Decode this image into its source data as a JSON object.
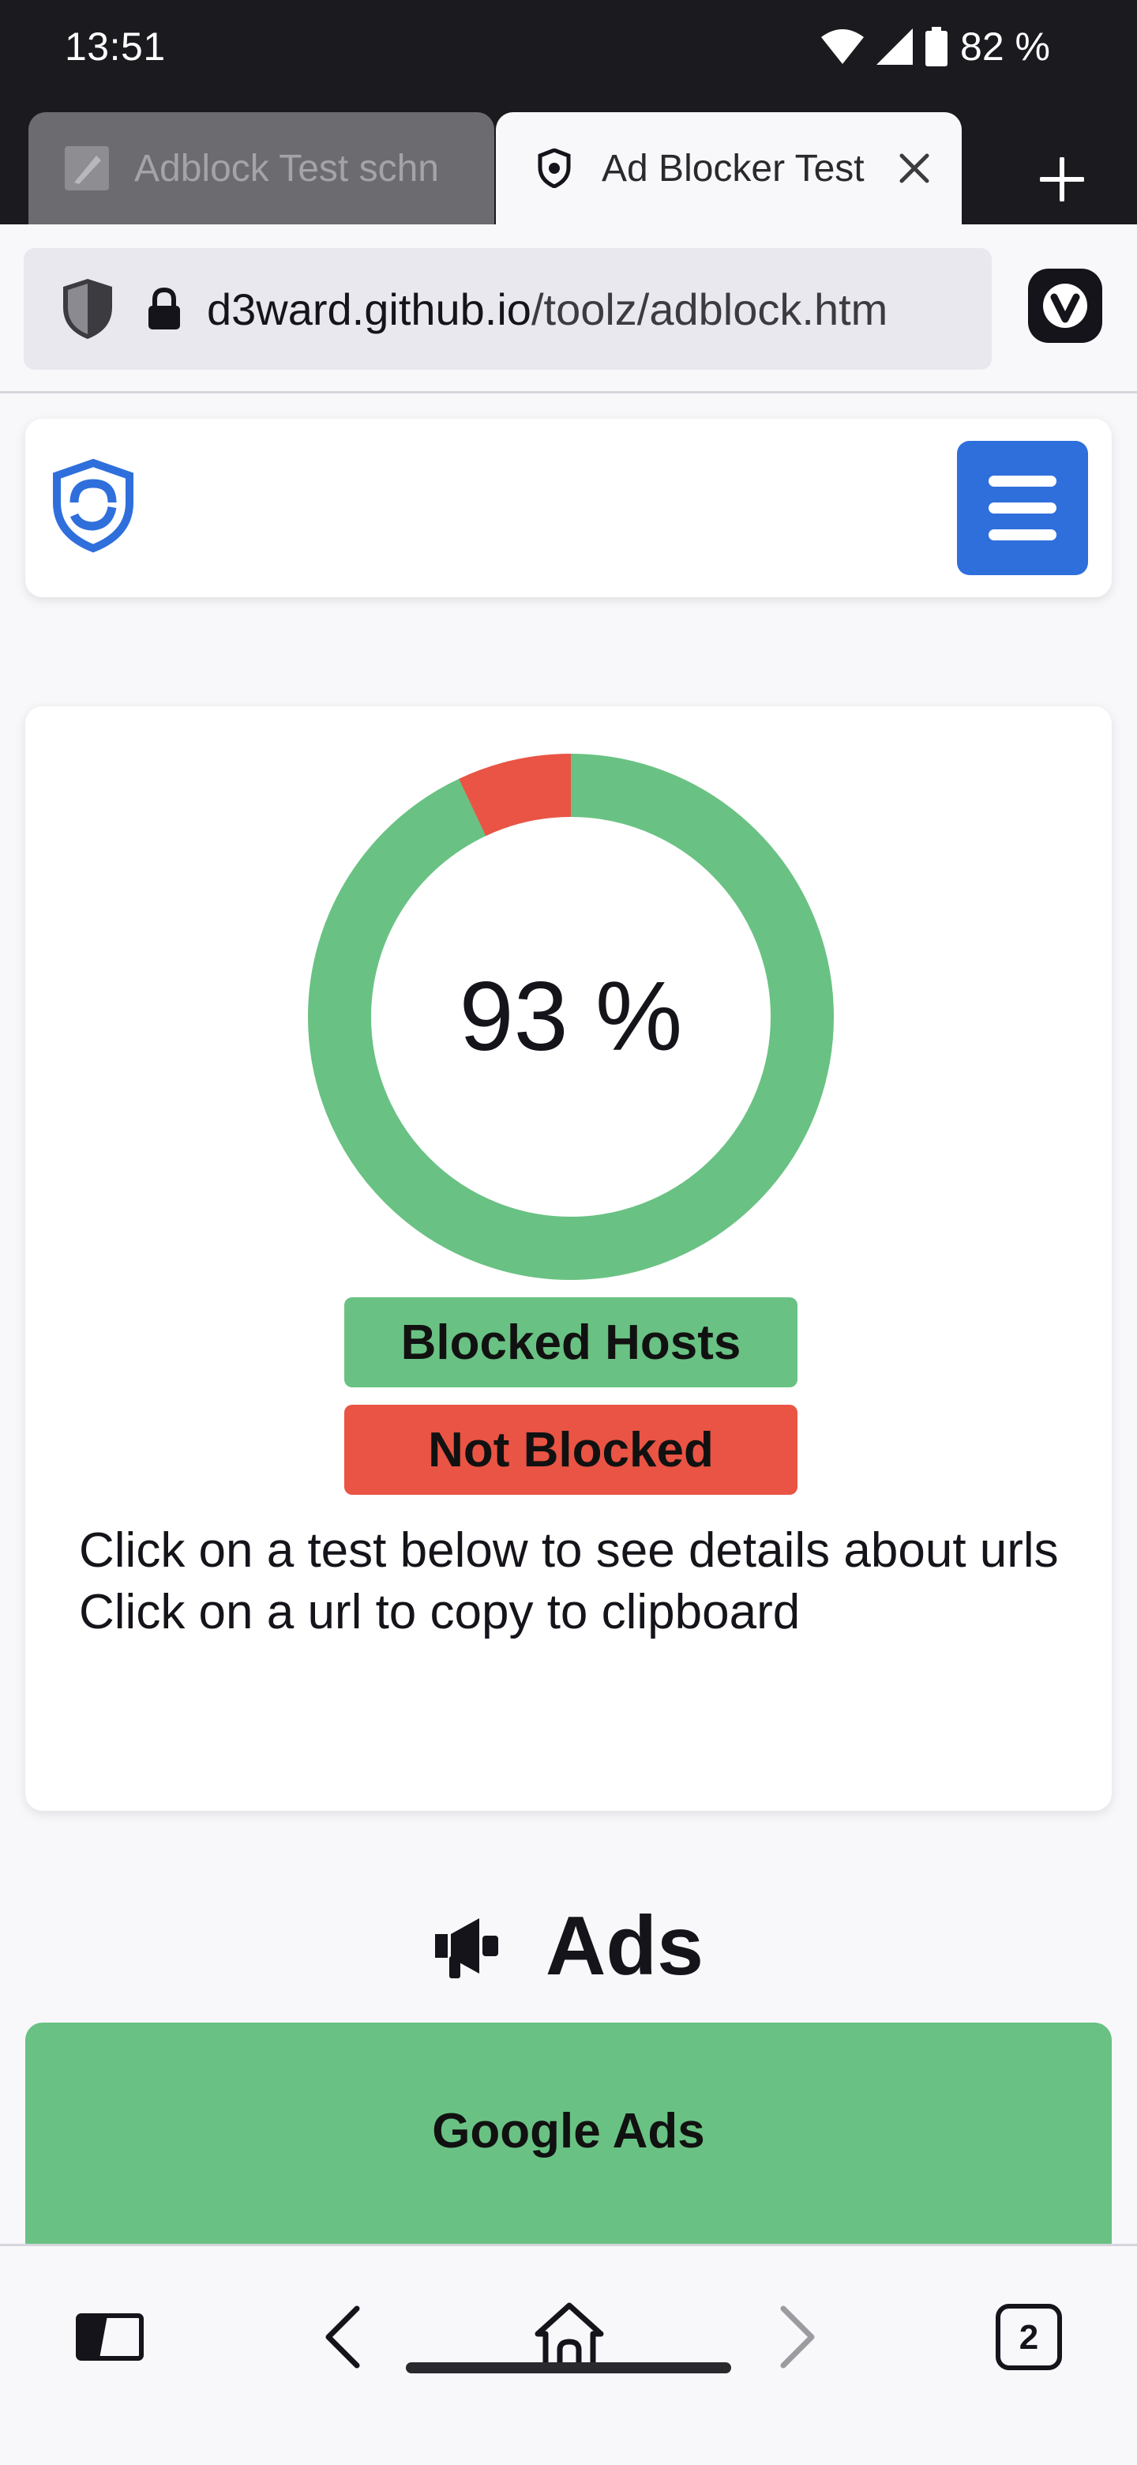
{
  "status_bar": {
    "time": "13:51",
    "battery": "82 %"
  },
  "tabs": [
    {
      "title": "Adblock Test schn",
      "active": false
    },
    {
      "title": "Ad Blocker Test",
      "active": true
    }
  ],
  "address_bar": {
    "url_host": "d3ward.github.io",
    "url_path": "/toolz/adblock.htm"
  },
  "result": {
    "percent_label": "93 %",
    "blocked_fraction": 0.93,
    "legend": {
      "blocked": "Blocked Hosts",
      "not_blocked": "Not Blocked"
    },
    "info_line1": "Click on a test below to see details about urls",
    "info_line2": "Click on a url to copy to clipboard"
  },
  "sections": [
    {
      "title": "Ads",
      "icon": "megaphone-icon",
      "first_test": "Google Ads"
    }
  ],
  "bottom_toolbar": {
    "tab_count": "2"
  },
  "colors": {
    "blocked": "#69c283",
    "not_blocked": "#e95444",
    "menu_button": "#2f6fdc"
  }
}
